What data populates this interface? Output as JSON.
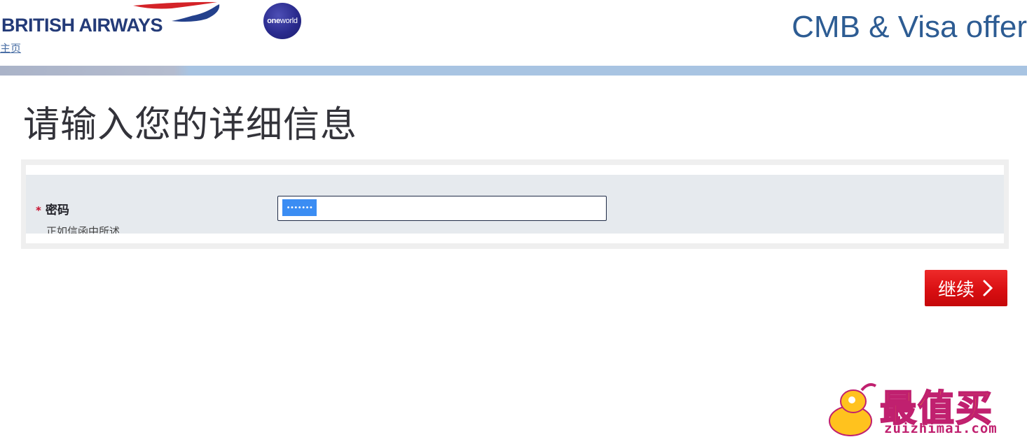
{
  "header": {
    "brand": "BRITISH AIRWAYS",
    "home_link": "主页",
    "oneworld_prefix": "one",
    "oneworld_suffix": "world",
    "site_title": "CMB & Visa offer"
  },
  "page": {
    "heading": "请输入您的详细信息"
  },
  "form": {
    "password_label": "密码",
    "required_marker": "*",
    "password_hint": "正如信函中所述",
    "password_masked": "•••••••",
    "continue_label": "继续"
  },
  "watermark": {
    "text": "最值买",
    "url": "zuizhimai.com"
  },
  "colors": {
    "brand_blue": "#243b78",
    "title_blue": "#2d5c93",
    "band": "#a8c4e2",
    "button_red": "#d90f12",
    "selection": "#3b8df3"
  },
  "icons": {
    "continue": "chevron-right-icon",
    "airline": "speedmarque-icon",
    "alliance": "oneworld-logo-icon"
  }
}
